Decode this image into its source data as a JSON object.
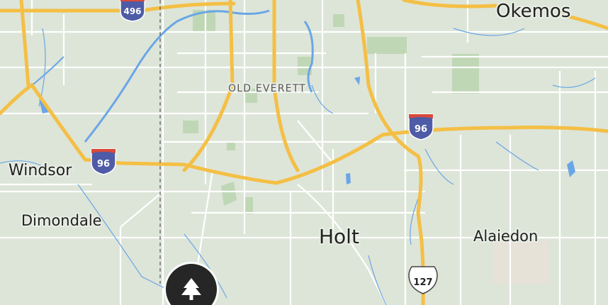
{
  "map": {
    "places": {
      "okemos": "Okemos",
      "old_everett": "OLD EVERETT",
      "windsor": "Windsor",
      "dimondale": "Dimondale",
      "holt": "Holt",
      "alaiedon": "Alaiedon"
    },
    "shields": {
      "i496": "496",
      "i96_west": "96",
      "i96_east": "96",
      "us127": "127"
    },
    "poi_icon": "park-tree-icon",
    "colors": {
      "land": "#dde5d8",
      "park": "#bfd7b5",
      "water": "#6aa6e6",
      "highway": "#f4bf45",
      "road": "#ffffff",
      "interstate_top": "#d94a3a",
      "interstate_body": "#4e5ba6",
      "boundary": "#555555"
    }
  }
}
